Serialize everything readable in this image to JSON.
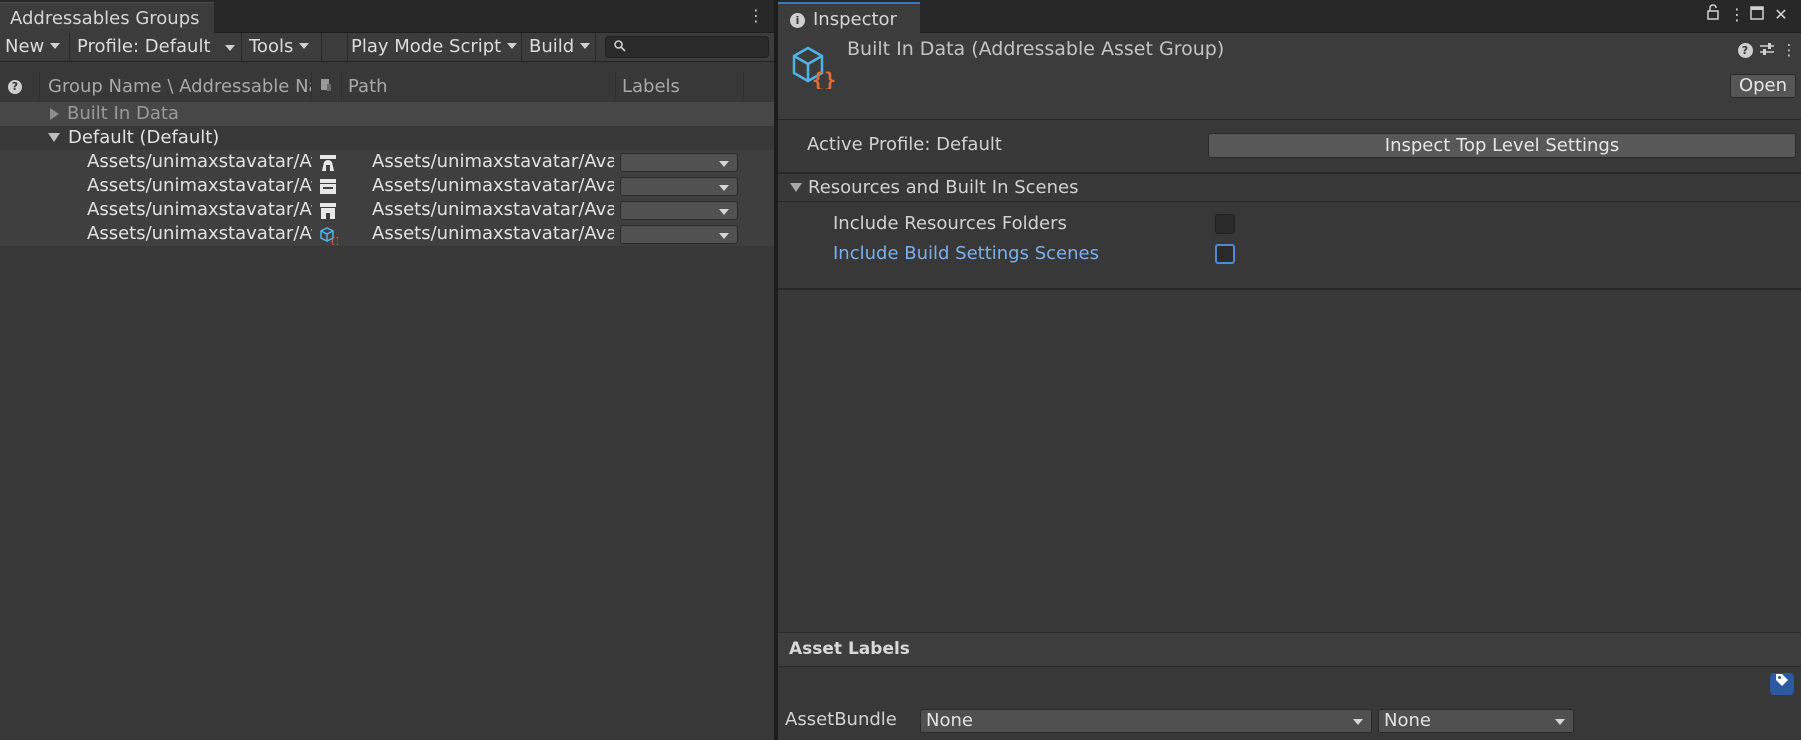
{
  "left_panel": {
    "tab_title": "Addressables Groups",
    "menu_icon": "kebab-menu-icon",
    "toolbar": {
      "new_label": "New",
      "profile_label": "Profile: Default",
      "tools_label": "Tools",
      "play_mode_label": "Play Mode Script",
      "build_label": "Build",
      "search_placeholder": ""
    },
    "columns": {
      "help": "help-icon",
      "name": "Group Name \\ Addressable Name",
      "path": "Path",
      "labels": "Labels"
    },
    "groups": [
      {
        "name": "Built In Data",
        "expanded": false
      },
      {
        "name": "Default (Default)",
        "expanded": true
      }
    ],
    "entries": [
      {
        "name": "Assets/unimaxstavatar/Av",
        "path": "Assets/unimaxstavatar/Avat",
        "icon": "sprite-icon"
      },
      {
        "name": "Assets/unimaxstavatar/Av",
        "path": "Assets/unimaxstavatar/Avat",
        "icon": "sprite-icon"
      },
      {
        "name": "Assets/unimaxstavatar/Av",
        "path": "Assets/unimaxstavatar/Avat",
        "icon": "sprite-icon"
      },
      {
        "name": "Assets/unimaxstavatar/Av",
        "path": "Assets/unimaxstavatar/Avat",
        "icon": "asset-group-icon"
      }
    ]
  },
  "inspector": {
    "tab_title": "Inspector",
    "title": "Built In Data (Addressable Asset Group)",
    "open_label": "Open",
    "active_profile_label": "Active Profile: Default",
    "inspect_button_label": "Inspect Top Level Settings",
    "section_title": "Resources and Built In Scenes",
    "options": [
      {
        "label": "Include Resources Folders",
        "checked": false
      },
      {
        "label": "Include Build Settings Scenes",
        "checked": false
      }
    ],
    "asset_labels_title": "Asset Labels",
    "asset_bundle_label": "AssetBundle",
    "asset_bundle_value": "None",
    "asset_bundle_variant": "None"
  },
  "colors": {
    "panel_bg": "#383838",
    "link_blue": "#7ab0ef",
    "accent_blue": "#3a79bb",
    "icon_orange": "#e06c3c",
    "icon_cyan": "#4fb3e6"
  }
}
